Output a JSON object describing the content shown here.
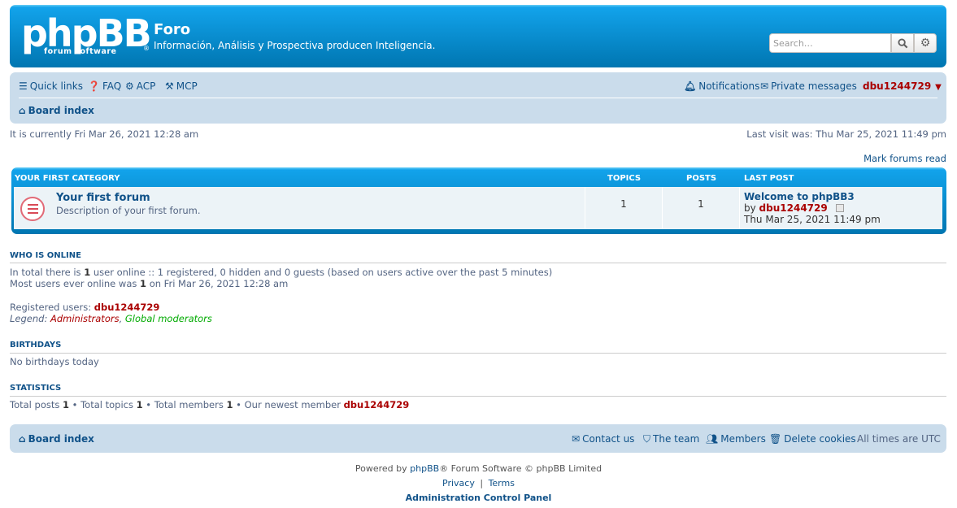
{
  "header": {
    "logo_main": "phpBB",
    "logo_sub": "forum  software",
    "logo_reg": "®",
    "site_title": "Foro",
    "site_desc": "Información, Análisis y Prospectiva producen Inteligencia.",
    "search_placeholder": "Search…",
    "search_icon": "search-icon",
    "advanced_icon": "gear-icon"
  },
  "nav": {
    "quick_links": "Quick links",
    "faq": "FAQ",
    "acp": "ACP",
    "mcp": "MCP",
    "notifications": "Notifications",
    "private_messages": "Private messages",
    "username": "dbu1244729",
    "board_index": "Board index"
  },
  "info": {
    "current_time": "It is currently Fri Mar 26, 2021 12:28 am",
    "last_visit": "Last visit was: Thu Mar 25, 2021 11:49 pm",
    "mark_read": "Mark forums read"
  },
  "category": {
    "name": "YOUR FIRST CATEGORY",
    "col_topics": "TOPICS",
    "col_posts": "POSTS",
    "col_last_post": "LAST POST",
    "forums": [
      {
        "title": "Your first forum",
        "description": "Description of your first forum.",
        "topics": "1",
        "posts": "1",
        "last_post_title": "Welcome to phpBB3",
        "last_post_by": "by",
        "last_post_user": "dbu1244729",
        "last_post_date": "Thu Mar 25, 2021 11:49 pm"
      }
    ]
  },
  "online": {
    "title": "WHO IS ONLINE",
    "line1_a": "In total there is ",
    "line1_count": "1",
    "line1_b": " user online :: 1 registered, 0 hidden and 0 guests (based on users active over the past 5 minutes)",
    "line2_a": "Most users ever online was ",
    "line2_count": "1",
    "line2_b": " on Fri Mar 26, 2021 12:28 am",
    "registered_label": "Registered users: ",
    "registered_user": "dbu1244729",
    "legend_label": "Legend: ",
    "legend_admins": "Administrators",
    "legend_sep": ", ",
    "legend_mods": "Global moderators"
  },
  "birthdays": {
    "title": "BIRTHDAYS",
    "text": "No birthdays today"
  },
  "statistics": {
    "title": "STATISTICS",
    "posts_label": "Total posts ",
    "posts": "1",
    "topics_label": " • Total topics ",
    "topics": "1",
    "members_label": " • Total members ",
    "members": "1",
    "newest_label": " • Our newest member ",
    "newest": "dbu1244729"
  },
  "footer": {
    "board_index": "Board index",
    "contact": "Contact us",
    "team": "The team",
    "members": "Members",
    "delete_cookies": "Delete cookies",
    "timezone": "All times are UTC",
    "powered_a": "Powered by ",
    "powered_link": "phpBB",
    "powered_b": "® Forum Software © phpBB Limited",
    "privacy": "Privacy",
    "sep": "|",
    "terms": "Terms",
    "acp": "Administration Control Panel"
  },
  "colors": {
    "accent": "#105289",
    "admin": "#AA0000",
    "moderator": "#00AA00",
    "header_blue": "#12a3eb"
  }
}
